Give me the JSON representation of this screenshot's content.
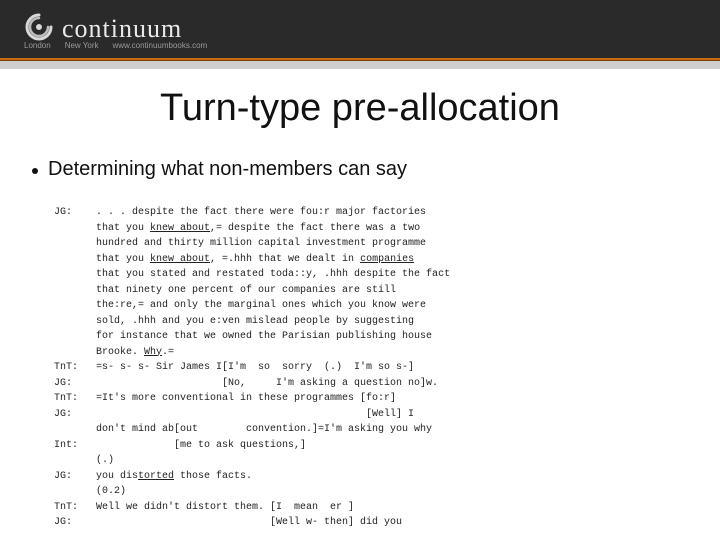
{
  "header": {
    "brand": "continuum",
    "sub_left": "London",
    "sub_mid": "New York",
    "sub_url": "www.continuumbooks.com"
  },
  "title": "Turn-type pre-allocation",
  "bullet_1": "Determining what non-members can say",
  "tx": {
    "l01a": "JG:    . . . despite the fact there were fou:r major factories",
    "l02a": "       that you ",
    "l02u": "knew about",
    "l02b": ",= despite the fact there was a two",
    "l03": "       hundred and thirty million capital investment programme",
    "l04a": "       that you ",
    "l04u": "knew about",
    "l04b": ", =.hhh that we dealt in ",
    "l04c": "companies",
    "l05": "       that you stated and restated toda::y, .hhh despite the fact",
    "l06": "       that ninety one percent of our companies are still",
    "l07": "       the:re,= and only the marginal ones which you know were",
    "l08": "       sold, .hhh and you e:ven mislead people by suggesting",
    "l09": "       for instance that we owned the Parisian publishing house",
    "l10a": "       Brooke. ",
    "l10u": "Why",
    "l10b": ".=",
    "l11": "TnT:   =s- s- s- Sir James I[I'm  so  sorry  (.)  I'm so s-]",
    "l12": "JG:                         [No,     I'm asking a question no]w.",
    "l13": "TnT:   =It's more conventional in these programmes [fo:r]",
    "l14": "JG:                                                 [Well] I",
    "l15": "       don't mind ab[out        convention.]=I'm asking you why",
    "l16": "Int:                [me to ask questions,]",
    "l17": "       (.)",
    "l18a": "JG:    you dis",
    "l18u": "torted",
    "l18b": " those facts.",
    "l19": "       (0.2)",
    "l20": "TnT:   Well we didn't distort them. [I  mean  er ]",
    "l21": "JG:                                 [Well w- then] did you"
  }
}
